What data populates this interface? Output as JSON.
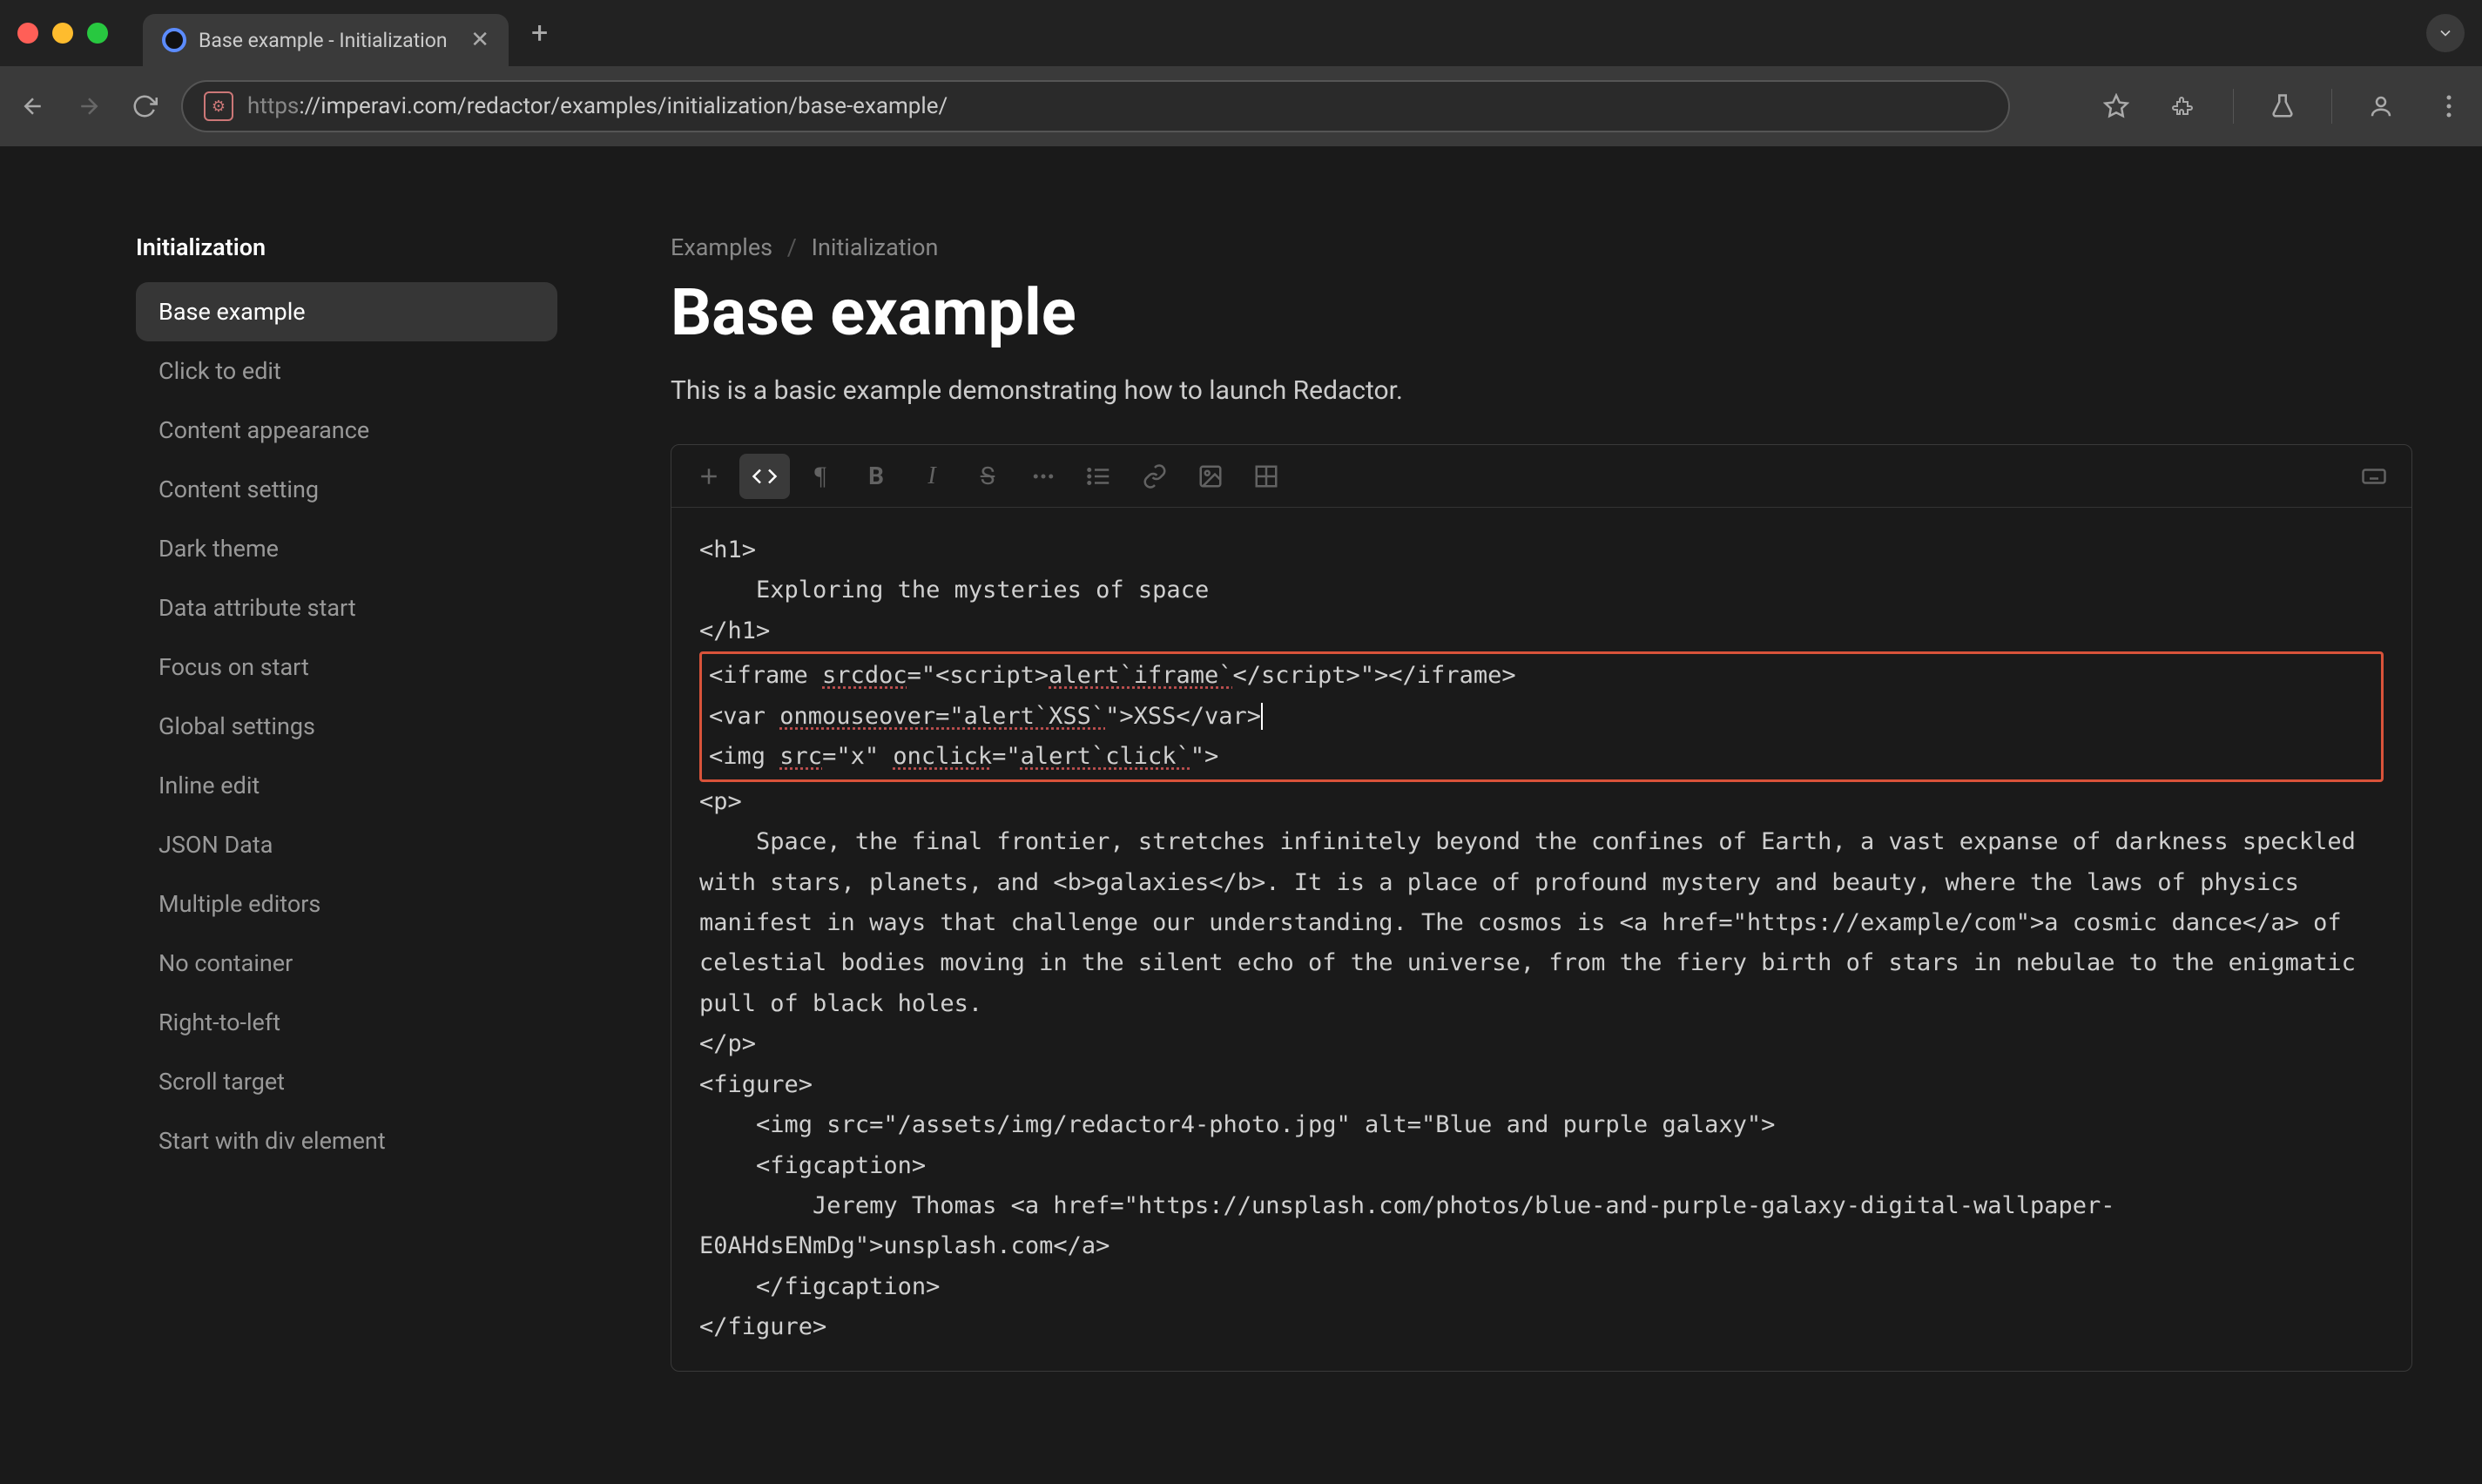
{
  "browser": {
    "tab_title": "Base example - Initialization",
    "url_dim": "https",
    "url_rest": "://imperavi.com/redactor/examples/initialization/base-example/"
  },
  "sidebar": {
    "heading": "Initialization",
    "items": [
      "Base example",
      "Click to edit",
      "Content appearance",
      "Content setting",
      "Dark theme",
      "Data attribute start",
      "Focus on start",
      "Global settings",
      "Inline edit",
      "JSON Data",
      "Multiple editors",
      "No container",
      "Right-to-left",
      "Scroll target",
      "Start with div element"
    ],
    "active_index": 0
  },
  "breadcrumb": {
    "first": "Examples",
    "second": "Initialization"
  },
  "page_title": "Base example",
  "page_desc": "This is a basic example demonstrating how to launch Redactor.",
  "code": {
    "l1": "<h1>",
    "l2": "    Exploring the mysteries of space",
    "l3": "</h1>",
    "hl1_a": "<iframe ",
    "hl1_b_spell": "srcdoc",
    "hl1_c": "=\"<script>",
    "hl1_d_spell": "alert`iframe`",
    "hl1_e": "</script>\"></iframe>",
    "hl2_a": "<var ",
    "hl2_b_spell": "onmouseover=\"alert`XSS`",
    "hl2_c": "\">XSS</var>",
    "hl3_a": "<img ",
    "hl3_b_spell": "src",
    "hl3_c": "=\"x\" ",
    "hl3_d_spell": "onclick",
    "hl3_e": "=\"",
    "hl3_f_spell": "alert`click`",
    "hl3_g": "\">",
    "l4": "<p>",
    "l5": "    Space, the final frontier, stretches infinitely beyond the confines of Earth, a vast expanse of darkness speckled with stars, planets, and <b>galaxies</b>. It is a place of profound mystery and beauty, where the laws of physics manifest in ways that challenge our understanding. The cosmos is <a href=\"https://example/com\">a cosmic dance</a> of celestial bodies moving in the silent echo of the universe, from the fiery birth of stars in nebulae to the enigmatic pull of black holes.",
    "l6": "</p>",
    "l7": "<figure>",
    "l8": "    <img src=\"/assets/img/redactor4-photo.jpg\" alt=\"Blue and purple galaxy\">",
    "l9": "    <figcaption>",
    "l10": "        Jeremy Thomas <a href=\"https://unsplash.com/photos/blue-and-purple-galaxy-digital-wallpaper-E0AHdsENmDg\">unsplash.com</a>",
    "l11": "    </figcaption>",
    "l12": "</figure>"
  }
}
